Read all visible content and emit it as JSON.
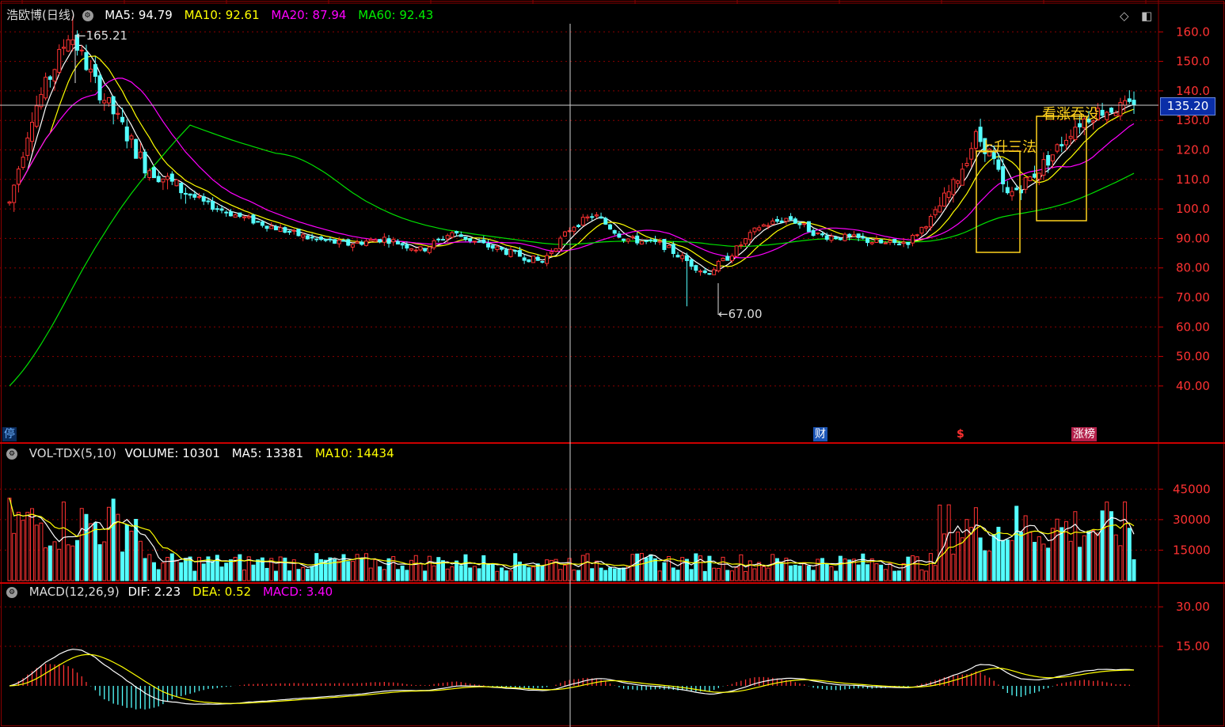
{
  "main": {
    "title": "浩欧博(日线)",
    "ma": [
      {
        "label": "MA5: 94.79",
        "color": "#ffffff"
      },
      {
        "label": "MA10: 92.61",
        "color": "#ffff00"
      },
      {
        "label": "MA20: 87.94",
        "color": "#ff00ff"
      },
      {
        "label": "MA60: 92.43",
        "color": "#00e000"
      }
    ],
    "price_ticks": [
      "160.0",
      "150.0",
      "140.0",
      "130.0",
      "120.0",
      "110.0",
      "100.0",
      "90.00",
      "80.00",
      "70.00",
      "60.00",
      "50.00",
      "40.00"
    ],
    "crosshair_price": "135.20",
    "high_label": "165.21",
    "low_label": "67.00",
    "annotation_1": "上升三法",
    "annotation_2": "看涨吞没",
    "badge_left": "停",
    "badge_finance": "财",
    "badge_money": "$",
    "badge_list": "涨榜"
  },
  "volume": {
    "title": "VOL-TDX(5,10)",
    "items": [
      {
        "label": "VOLUME: 10301",
        "color": "#ffffff"
      },
      {
        "label": "MA5: 13381",
        "color": "#ffffff"
      },
      {
        "label": "MA10: 14434",
        "color": "#ffff00"
      }
    ],
    "ticks": [
      "45000",
      "30000",
      "15000"
    ]
  },
  "macd": {
    "title": "MACD(12,26,9)",
    "items": [
      {
        "label": "DIF: 2.23",
        "color": "#ffffff"
      },
      {
        "label": "DEA: 0.52",
        "color": "#ffff00"
      },
      {
        "label": "MACD: 3.40",
        "color": "#ff00ff"
      }
    ],
    "ticks": [
      "30.00",
      "15.00"
    ]
  },
  "chart_data": {
    "type": "candlestick",
    "price_ticks": [
      160,
      150,
      140,
      130,
      120,
      110,
      100,
      90,
      80,
      70,
      60,
      50,
      40
    ],
    "volume_ticks": [
      45000,
      30000,
      15000
    ],
    "macd_ticks": [
      30,
      15
    ],
    "high": 165.21,
    "low": 67.0,
    "last_close": 135.2,
    "colors": {
      "up": "#ff3232",
      "down": "#54ffff",
      "ma5": "#ffffff",
      "ma10": "#ffff00",
      "ma20": "#ff00ff",
      "ma60": "#00e000",
      "grid": "#8b0000"
    }
  }
}
